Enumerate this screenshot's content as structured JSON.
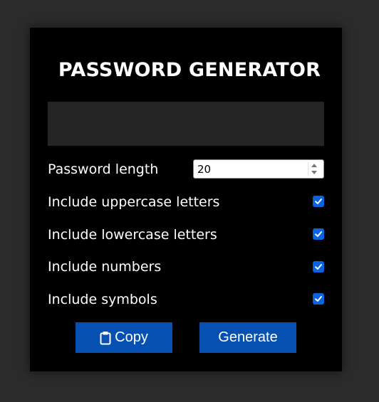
{
  "app": {
    "title": "PASSWORD GENERATOR",
    "password_output": ""
  },
  "options": {
    "length_label": "Password length",
    "length_value": "20",
    "uppercase_label": "Include uppercase letters",
    "uppercase_checked": true,
    "lowercase_label": "Include lowercase letters",
    "lowercase_checked": true,
    "numbers_label": "Include numbers",
    "numbers_checked": true,
    "symbols_label": "Include symbols",
    "symbols_checked": true
  },
  "buttons": {
    "copy_label": "Copy",
    "copy_icon": "clipboard-icon",
    "generate_label": "Generate"
  },
  "colors": {
    "page_bg": "#2b2b2b",
    "card_bg": "#000000",
    "output_bg": "#252525",
    "button_bg": "#0550b0",
    "checkbox": "#0a63e0"
  }
}
